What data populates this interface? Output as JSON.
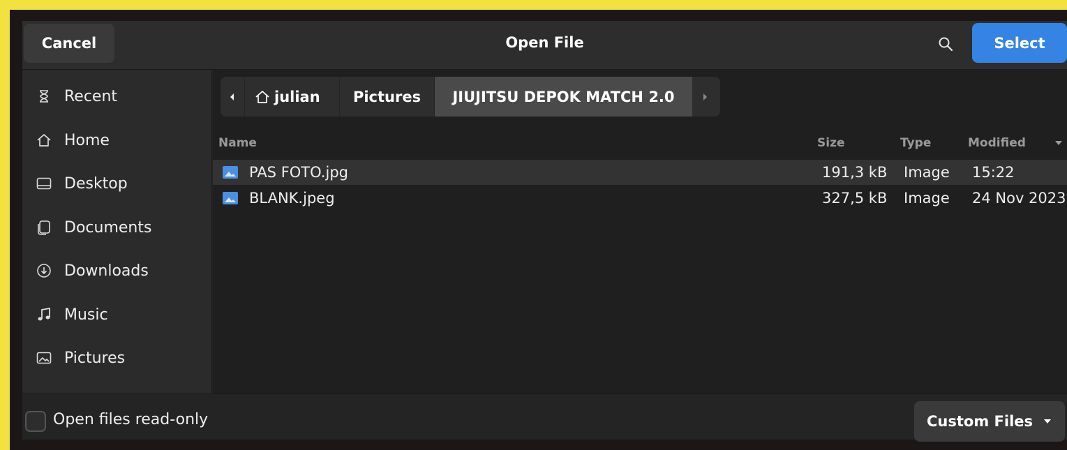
{
  "header": {
    "title": "Open File",
    "cancel_label": "Cancel",
    "select_label": "Select",
    "search_icon": "search-icon"
  },
  "sidebar": {
    "items": [
      {
        "label": "Recent",
        "icon": "clock-icon"
      },
      {
        "label": "Home",
        "icon": "home-icon"
      },
      {
        "label": "Desktop",
        "icon": "desktop-icon"
      },
      {
        "label": "Documents",
        "icon": "document-icon"
      },
      {
        "label": "Downloads",
        "icon": "download-icon"
      },
      {
        "label": "Music",
        "icon": "music-icon"
      },
      {
        "label": "Pictures",
        "icon": "picture-icon"
      }
    ]
  },
  "path": {
    "crumbs": [
      "julian",
      "Pictures",
      "JIUJITSU DEPOK MATCH 2.0"
    ],
    "active": "JIUJITSU DEPOK MATCH 2.0"
  },
  "columns": {
    "name": "Name",
    "size": "Size",
    "type": "Type",
    "modified": "Modified"
  },
  "files": [
    {
      "name": "PAS FOTO.jpg",
      "size": "191,3 kB",
      "type": "Image",
      "modified": "15:22",
      "selected": true
    },
    {
      "name": "BLANK.jpeg",
      "size": "327,5 kB",
      "type": "Image",
      "modified": "24 Nov 2023",
      "selected": false
    }
  ],
  "footer": {
    "readonly_label": "Open files read-only",
    "readonly_checked": false,
    "filter_label": "Custom Files"
  },
  "colors": {
    "accent": "#3584e4",
    "frame": "#f2e23f",
    "background": "#242424"
  }
}
